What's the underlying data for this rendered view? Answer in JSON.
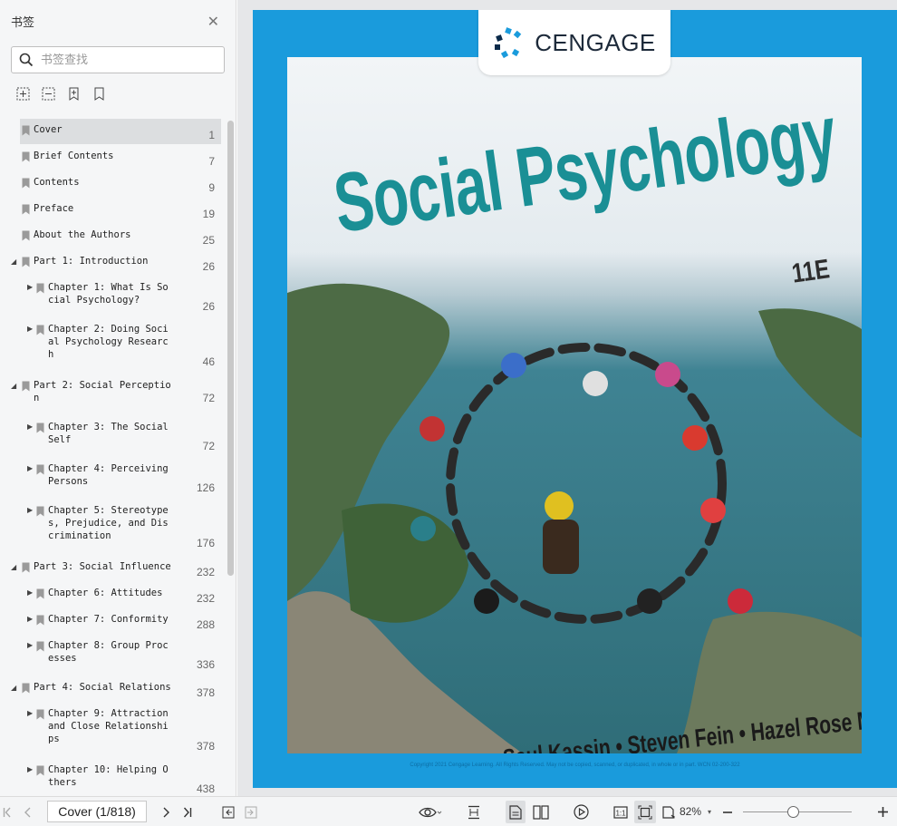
{
  "sidebar": {
    "title": "书签",
    "search_placeholder": "书签查找",
    "bookmarks": [
      {
        "label": "Cover",
        "page": "1",
        "level": 0
      },
      {
        "label": "Brief Contents",
        "page": "7",
        "level": 0
      },
      {
        "label": "Contents",
        "page": "9",
        "level": 0
      },
      {
        "label": "Preface",
        "page": "19",
        "level": 0
      },
      {
        "label": "About the Authors",
        "page": "25",
        "level": 0
      },
      {
        "label": "Part 1: Introduction",
        "page": "26",
        "level": 0
      },
      {
        "label": "Chapter 1: What Is So\ncial Psychology?",
        "page": "26",
        "level": 1
      },
      {
        "label": "Chapter 2: Doing Soci\nal Psychology Researc\nh",
        "page": "46",
        "level": 1
      },
      {
        "label": "Part 2: Social Perceptio\nn",
        "page": "72",
        "level": 0
      },
      {
        "label": "Chapter 3: The Social\nSelf",
        "page": "72",
        "level": 1
      },
      {
        "label": "Chapter 4: Perceiving\nPersons",
        "page": "126",
        "level": 1
      },
      {
        "label": "Chapter 5: Stereotype\ns, Prejudice, and Dis\ncrimination",
        "page": "176",
        "level": 1
      },
      {
        "label": "Part 3: Social Influence",
        "page": "232",
        "level": 0
      },
      {
        "label": "Chapter 6: Attitudes",
        "page": "232",
        "level": 1
      },
      {
        "label": "Chapter 7: Conformity",
        "page": "288",
        "level": 1
      },
      {
        "label": "Chapter 8: Group Proc\nesses",
        "page": "336",
        "level": 1
      },
      {
        "label": "Part 4: Social Relations",
        "page": "378",
        "level": 0
      },
      {
        "label": "Chapter 9: Attraction\nand Close Relationshi\nps",
        "page": "378",
        "level": 1
      },
      {
        "label": "Chapter 10: Helping O\nthers",
        "page": "438",
        "level": 1
      }
    ]
  },
  "cover": {
    "brand": "CENGAGE",
    "title": "Social Psychology",
    "edition": "11E",
    "authors": "Saul Kassin • Steven Fein • Hazel Rose Markus",
    "copyright": "Copyright 2021 Cengage Learning. All Rights Reserved. May not be copied, scanned, or duplicated, in whole or in part.  WCN 02-200-322"
  },
  "toolbar": {
    "page_indicator": "Cover (1/818)",
    "zoom": "82%"
  },
  "colors": {
    "cover_blue": "#1a9bdc",
    "title_teal": "#1a8f95",
    "selected_row": "#dcdee0"
  }
}
